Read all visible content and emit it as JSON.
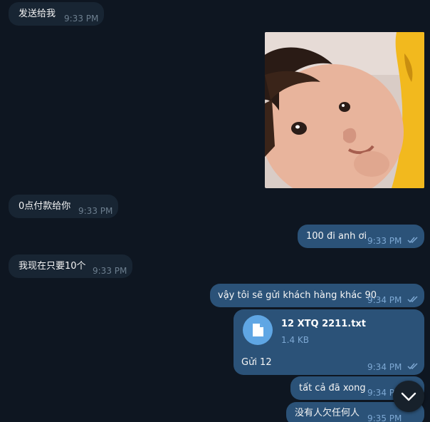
{
  "colors": {
    "background": "#0e1621",
    "incoming_bubble": "#182533",
    "outgoing_bubble": "#2b5278",
    "time_incoming": "#6d7f8f",
    "time_outgoing": "#7da8d3",
    "file_icon": "#5fa6e4"
  },
  "messages": [
    {
      "direction": "incoming",
      "text": "发送给我",
      "time": "9:33 PM"
    },
    {
      "direction": "outgoing",
      "type": "photo",
      "image": "toddler-face-photo"
    },
    {
      "direction": "incoming",
      "text": "0点付款给你",
      "time": "9:33 PM"
    },
    {
      "direction": "outgoing",
      "text": "100 đi anh ơi",
      "time": "9:33 PM",
      "read": true
    },
    {
      "direction": "incoming",
      "text": "我现在只要10个",
      "time": "9:33 PM"
    },
    {
      "direction": "outgoing",
      "text": "vậy tôi sẽ gửi khách hàng khác 90",
      "time": "9:34 PM",
      "read": true
    },
    {
      "direction": "outgoing",
      "type": "file",
      "file_name": "12 XTQ 2211.txt",
      "file_size": "1.4 KB",
      "caption": "Gửi 12",
      "time": "9:34 PM",
      "read": true,
      "icon": "document-icon"
    },
    {
      "direction": "outgoing",
      "text": "tất cả đã xong",
      "time": "9:34 PM",
      "read": true
    },
    {
      "direction": "outgoing",
      "text": "没有人欠任何人",
      "time": "9:35 PM",
      "read": true
    }
  ],
  "scroll_button": {
    "icon": "chevron-down-icon"
  }
}
